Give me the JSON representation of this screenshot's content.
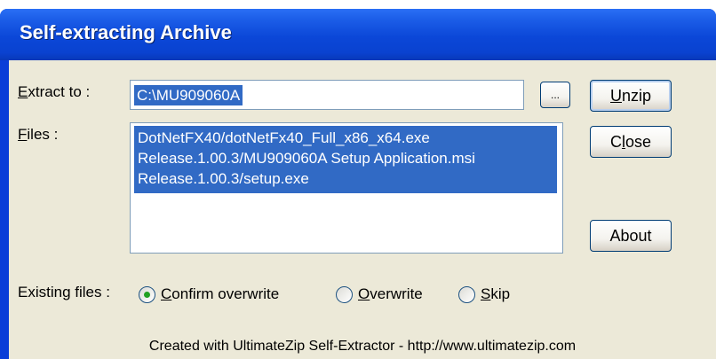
{
  "window": {
    "title": "Self-extracting Archive"
  },
  "extract": {
    "label_prefix": "",
    "label_accel": "E",
    "label_rest": "xtract to :",
    "path_value": "C:\\MU909060A",
    "browse_label": "..."
  },
  "files": {
    "label_accel": "F",
    "label_rest": "iles :",
    "items": [
      "DotNetFX40/dotNetFx40_Full_x86_x64.exe",
      "Release.1.00.3/MU909060A Setup Application.msi",
      "Release.1.00.3/setup.exe"
    ]
  },
  "buttons": {
    "unzip_accel": "U",
    "unzip_rest": "nzip",
    "close_pre": "C",
    "close_accel": "l",
    "close_rest": "ose",
    "about": "About"
  },
  "existing": {
    "label": "Existing files :",
    "options": [
      {
        "accel": "C",
        "rest": "onfirm overwrite",
        "selected": true
      },
      {
        "accel": "O",
        "rest": "verwrite",
        "selected": false
      },
      {
        "accel": "S",
        "rest": "kip",
        "selected": false
      }
    ]
  },
  "footer": {
    "text": "Created with UltimateZip Self-Extractor - http://www.ultimatezip.com"
  },
  "colors": {
    "titlebar": "#0a42d0",
    "selection": "#316ac5",
    "client": "#ece9d8",
    "radio_dot": "#21a121"
  }
}
